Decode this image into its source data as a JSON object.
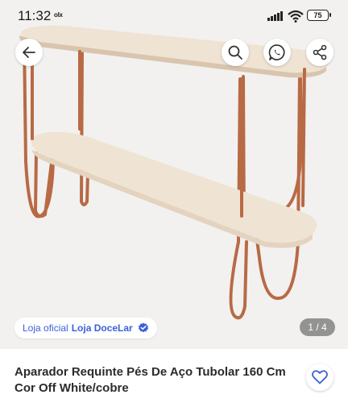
{
  "status_bar": {
    "time": "11:32",
    "app_icon": "olx",
    "battery": "75"
  },
  "gallery": {
    "page_counter": "1 / 4",
    "store_badge": {
      "prefix": "Loja oficial",
      "name": "Loja DoceLar",
      "verified_icon": "verified-check-icon"
    }
  },
  "toolbar": {
    "back_icon": "arrow-left-icon",
    "search_icon": "search-icon",
    "whatsapp_icon": "whatsapp-icon",
    "share_icon": "share-icon"
  },
  "product": {
    "title": "Aparador Requinte Pés De Aço Tubolar 160 Cm Cor Off White/cobre",
    "favorite_icon": "heart-icon"
  },
  "colors": {
    "accent": "#3b5fd9",
    "shelf": "#f1e6d8",
    "legs": "#b86a45"
  }
}
